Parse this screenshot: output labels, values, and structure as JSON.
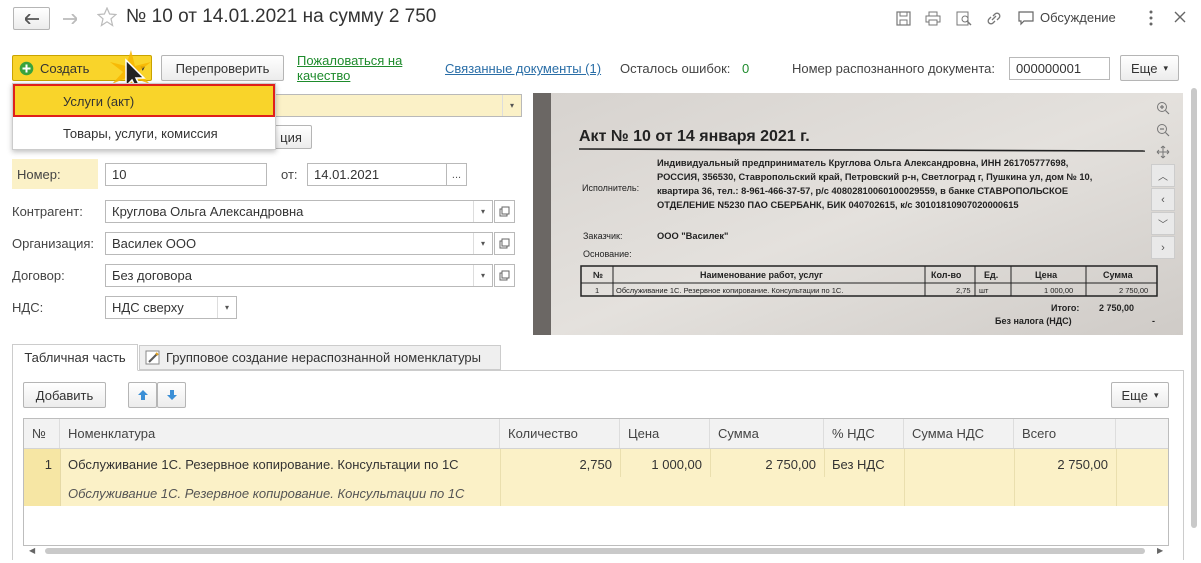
{
  "window": {
    "title": "№ 10 от 14.01.2021 на сумму 2 750",
    "discussion_label": "Обсуждение"
  },
  "toolbar": {
    "create_label": "Создать",
    "recheck_label": "Перепроверить",
    "complain_label": "Пожаловаться на качество",
    "complain_line1": "Пожаловаться на",
    "complain_line2": "качество",
    "related_docs_label": "Связанные документы (1)",
    "errors_left_label": "Осталось ошибок:",
    "errors_left_value": "0",
    "recognized_doc_label": "Номер распознанного документа:",
    "recognized_doc_value": "000000001",
    "more_label": "Еще"
  },
  "create_menu": {
    "items": [
      {
        "label": "Услуги (акт)",
        "selected": true
      },
      {
        "label": "Товары, услуги, комиссия",
        "selected": false
      }
    ]
  },
  "form": {
    "hidden_button_fragment": "ция",
    "number_label": "Номер:",
    "number_value": "10",
    "date_label": "от:",
    "date_value": "14.01.2021",
    "date_button": "...",
    "counterparty_label": "Контрагент:",
    "counterparty_value": "Круглова Ольга Александровна",
    "organization_label": "Организация:",
    "organization_value": "Василек ООО",
    "contract_label": "Договор:",
    "contract_value": "Без договора",
    "vat_label": "НДС:",
    "vat_value": "НДС сверху"
  },
  "scan": {
    "title": "Акт № 10 от 14 января 2021 г.",
    "executor_label": "Исполнитель:",
    "executor_lines": [
      "Индивидуальный предприниматель Круглова Ольга Александровна, ИНН 261705777698,",
      "РОССИЯ, 356530, Ставропольский край, Петровский р-н, Светлоград г, Пушкина ул, дом № 10,",
      "квартира 36, тел.: 8-961-466-37-57, р/с 40802810060100029559, в банке СТАВРОПОЛЬСКОЕ",
      "ОТДЕЛЕНИЕ N5230 ПАО СБЕРБАНК, БИК 040702615, к/с 30101810907020000615"
    ],
    "customer_label": "Заказчик:",
    "customer_value": "ООО \"Василек\"",
    "basis_label": "Основание:",
    "table_headers": [
      "№",
      "Наименование работ, услуг",
      "Кол-во",
      "Ед.",
      "Цена",
      "Сумма"
    ],
    "table_row": [
      "1",
      "Обслуживание 1С. Резервное копирование. Консультации по 1С.",
      "2,75",
      "шт",
      "1 000,00",
      "2 750,00"
    ],
    "total_label": "Итого:",
    "total_value": "2 750,00",
    "no_vat_label": "Без налога (НДС)",
    "no_vat_value": "-"
  },
  "tabs": [
    {
      "label": "Табличная часть",
      "active": true
    },
    {
      "label": "Групповое создание нераспознанной номенклатуры",
      "active": false
    }
  ],
  "table_toolbar": {
    "add_label": "Добавить",
    "more_label": "Еще"
  },
  "table": {
    "headers": [
      "№",
      "Номенклатура",
      "Количество",
      "Цена",
      "Сумма",
      "% НДС",
      "Сумма НДС",
      "Всего"
    ],
    "rows": [
      {
        "n": "1",
        "nomenclature": "Обслуживание 1С. Резервное копирование. Консультации по 1С",
        "nomenclature_sub": "Обслуживание 1С. Резервное копирование. Консультации по 1С",
        "quantity": "2,750",
        "price": "1 000,00",
        "sum": "2 750,00",
        "vat_rate": "Без НДС",
        "vat_sum": "",
        "total": "2 750,00"
      }
    ]
  },
  "colors": {
    "accent_yellow": "#f9d42a",
    "row_highlight": "#fbf1c7",
    "selection_border": "#e0201b",
    "link": "#2a6ea7",
    "green_link": "#1e8b2c"
  }
}
